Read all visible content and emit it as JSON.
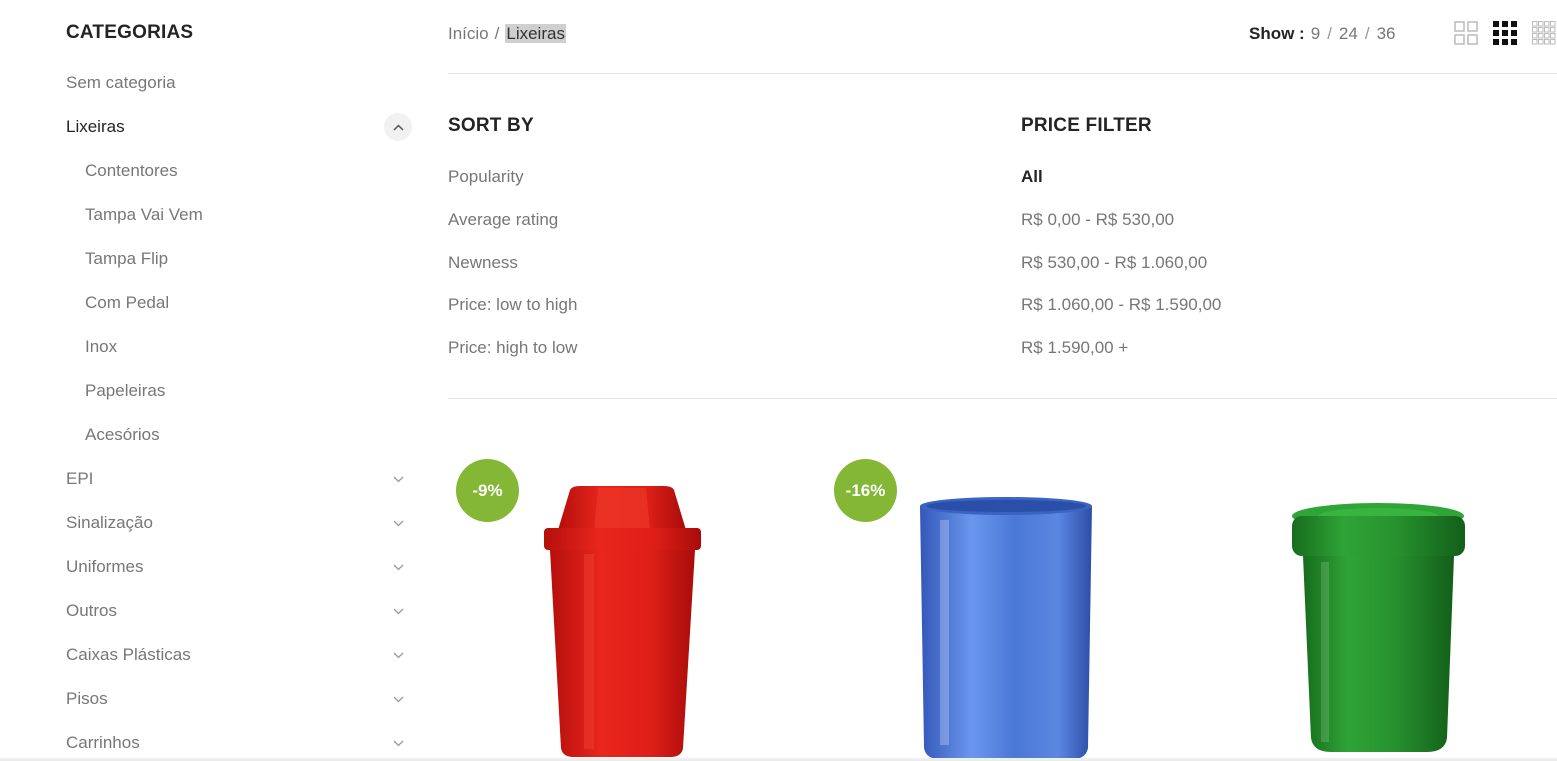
{
  "sidebar": {
    "title": "CATEGORIAS",
    "categories": [
      {
        "label": "Sem categoria"
      },
      {
        "label": "Lixeiras"
      },
      {
        "label": "Contentores"
      },
      {
        "label": "Tampa Vai Vem"
      },
      {
        "label": "Tampa Flip"
      },
      {
        "label": "Com Pedal"
      },
      {
        "label": "Inox"
      },
      {
        "label": "Papeleiras"
      },
      {
        "label": "Acesórios"
      },
      {
        "label": "EPI"
      },
      {
        "label": "Sinalização"
      },
      {
        "label": "Uniformes"
      },
      {
        "label": "Outros"
      },
      {
        "label": "Caixas Plásticas"
      },
      {
        "label": "Pisos"
      },
      {
        "label": "Carrinhos"
      }
    ]
  },
  "breadcrumb": {
    "home": "Início",
    "separator": "/",
    "current": "Lixeiras"
  },
  "show": {
    "label": "Show :",
    "options": [
      "9",
      "24",
      "36"
    ],
    "separator": "/"
  },
  "view_modes": [
    "grid-2-icon",
    "grid-3-icon",
    "grid-4-icon"
  ],
  "sort": {
    "title": "SORT BY",
    "options": [
      "Popularity",
      "Average rating",
      "Newness",
      "Price: low to high",
      "Price: high to low"
    ]
  },
  "price_filter": {
    "title": "PRICE FILTER",
    "options": [
      "All",
      "R$ 0,00 - R$ 530,00",
      "R$ 530,00 - R$ 1.060,00",
      "R$ 1.060,00 - R$ 1.590,00",
      "R$ 1.590,00 +"
    ],
    "selected": "All"
  },
  "products": [
    {
      "badge": "-9%",
      "image": "red-swing-lid-bin",
      "color": "#e0231b"
    },
    {
      "badge": "-16%",
      "image": "blue-open-bin",
      "color": "#4a78d6"
    },
    {
      "badge": "",
      "image": "green-lidded-bin",
      "color": "#27922f"
    }
  ],
  "colors": {
    "accent_badge": "#83b735",
    "heading": "#242424",
    "text": "#777777"
  }
}
